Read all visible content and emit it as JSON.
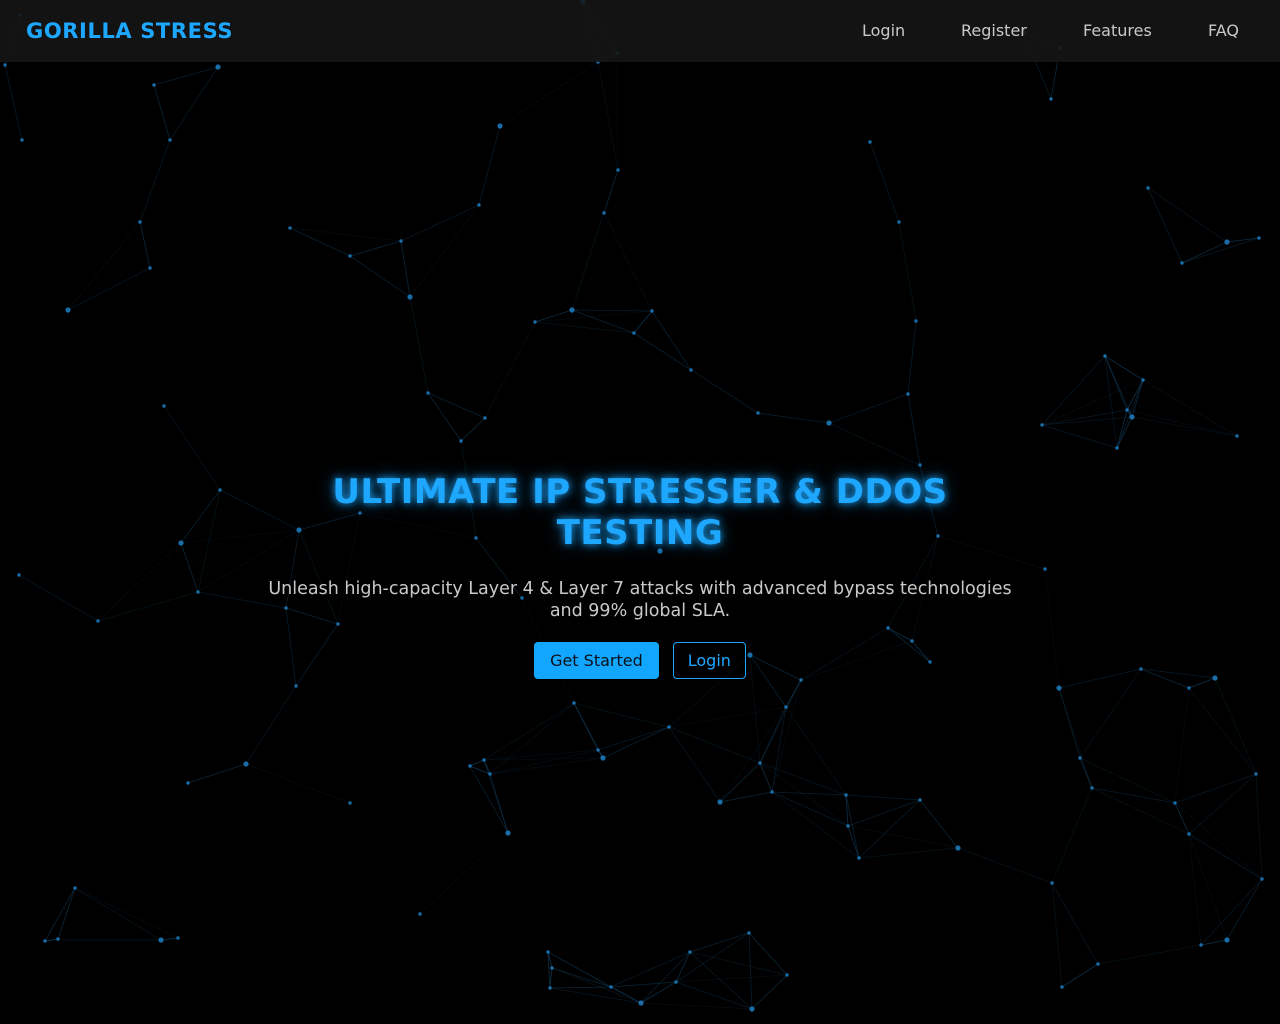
{
  "brand": {
    "name": "GORILLA STRESS"
  },
  "nav": {
    "login": "Login",
    "register": "Register",
    "features": "Features",
    "faq": "FAQ"
  },
  "hero": {
    "title": "ULTIMATE IP STRESSER & DDOS TESTING",
    "subtitle": "Unleash high-capacity Layer 4 & Layer 7 attacks with advanced bypass technologies and 99% global SLA.",
    "primary_button": "Get Started",
    "secondary_button": "Login"
  },
  "colors": {
    "accent": "#1ea7ff",
    "background": "#000000",
    "navbar": "#161616",
    "text": "#c9c9c9"
  }
}
